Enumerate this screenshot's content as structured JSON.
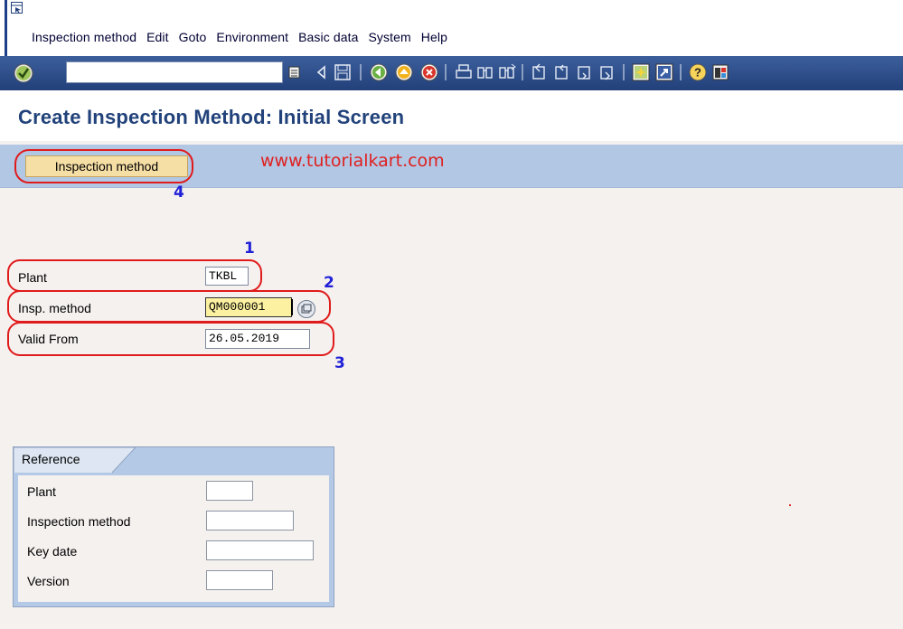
{
  "menu": {
    "items": [
      "Inspection method",
      "Edit",
      "Goto",
      "Environment",
      "Basic data",
      "System",
      "Help"
    ]
  },
  "toolbar": {
    "command_value": "",
    "icons": [
      "enter-check-icon",
      "command-dropdown-icon",
      "back-arrow-icon",
      "save-icon",
      "back-icon",
      "exit-icon",
      "cancel-icon",
      "print-icon",
      "find-icon",
      "find-next-icon",
      "first-page-icon",
      "previous-page-icon",
      "next-page-icon",
      "last-page-icon",
      "create-session-icon",
      "shortcut-icon",
      "help-icon",
      "layout-icon"
    ]
  },
  "page": {
    "title": "Create Inspection Method: Initial Screen"
  },
  "app_toolbar": {
    "button_label": "Inspection method"
  },
  "annotations": {
    "watermark": "www.tutorialkart.com",
    "n1": "1",
    "n2": "2",
    "n3": "3",
    "n4": "4"
  },
  "form": {
    "plant_label": "Plant",
    "plant_value": "TKBL",
    "method_label": "Insp. method",
    "method_value": "QM000001",
    "valid_label": "Valid From",
    "valid_value": "26.05.2019"
  },
  "reference": {
    "title": "Reference",
    "plant_label": "Plant",
    "method_label": "Inspection method",
    "keydate_label": "Key date",
    "version_label": "Version"
  },
  "colors": {
    "toolbar_blue": "#2b4e8b",
    "title_blue": "#21427a",
    "app_toolbar": "#b1c7e4",
    "button_fill": "#f6dfa5",
    "annotation_red": "#e01b1b",
    "annotation_blue": "#2020d8",
    "focus_yellow": "#fbf1a0"
  }
}
